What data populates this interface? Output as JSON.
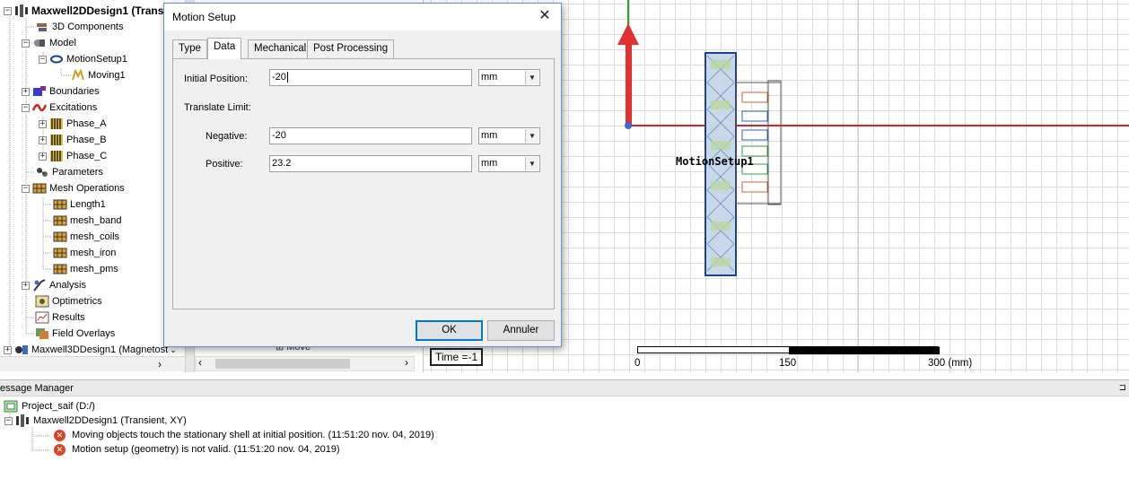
{
  "tree": {
    "items": [
      {
        "label": "Maxwell2DDesign1 (Trans",
        "bold": true
      },
      {
        "label": "3D Components"
      },
      {
        "label": "Model"
      },
      {
        "label": "MotionSetup1"
      },
      {
        "label": "Moving1"
      },
      {
        "label": "Boundaries"
      },
      {
        "label": "Excitations"
      },
      {
        "label": "Phase_A"
      },
      {
        "label": "Phase_B"
      },
      {
        "label": "Phase_C"
      },
      {
        "label": "Parameters"
      },
      {
        "label": "Mesh Operations"
      },
      {
        "label": "Length1"
      },
      {
        "label": "mesh_band"
      },
      {
        "label": "mesh_coils"
      },
      {
        "label": "mesh_iron"
      },
      {
        "label": "mesh_pms"
      },
      {
        "label": "Analysis"
      },
      {
        "label": "Optimetrics"
      },
      {
        "label": "Results"
      },
      {
        "label": "Field Overlays"
      },
      {
        "label": "Maxwell3DDesign1 (Magnetost"
      }
    ]
  },
  "midpanel": {
    "partial_label": "Move"
  },
  "canvas": {
    "time_label": "Time =-1",
    "object_label": "MotionSetup1",
    "scale": {
      "ticks": [
        "0",
        "150",
        "300 (mm)"
      ]
    }
  },
  "dialog": {
    "title": "Motion Setup",
    "close_glyph": "✕",
    "tabs": [
      "Type",
      "Data",
      "Mechanical",
      "Post Processing"
    ],
    "active_tab": "Data",
    "initial_position": {
      "label": "Initial Position:",
      "value": "-20",
      "unit": "mm"
    },
    "translate_limit_label": "Translate Limit:",
    "negative": {
      "label": "Negative:",
      "value": "-20",
      "unit": "mm"
    },
    "positive": {
      "label": "Positive:",
      "value": "23.2",
      "unit": "mm"
    },
    "ok_label": "OK",
    "cancel_label": "Annuler"
  },
  "message_manager": {
    "title": "essage Manager",
    "project": "Project_saif (D:/)",
    "design": "Maxwell2DDesign1 (Transient, XY)",
    "messages": [
      "Moving objects touch the stationary shell at initial position. (11:51:20  nov. 04, 2019)",
      "Motion setup (geometry) is not valid. (11:51:20  nov. 04, 2019)"
    ]
  },
  "colors": {
    "axis_x": "#e02020",
    "axis_y": "#2aa02a",
    "dialog_border": "#5a8fd0",
    "error": "#d9472b"
  }
}
